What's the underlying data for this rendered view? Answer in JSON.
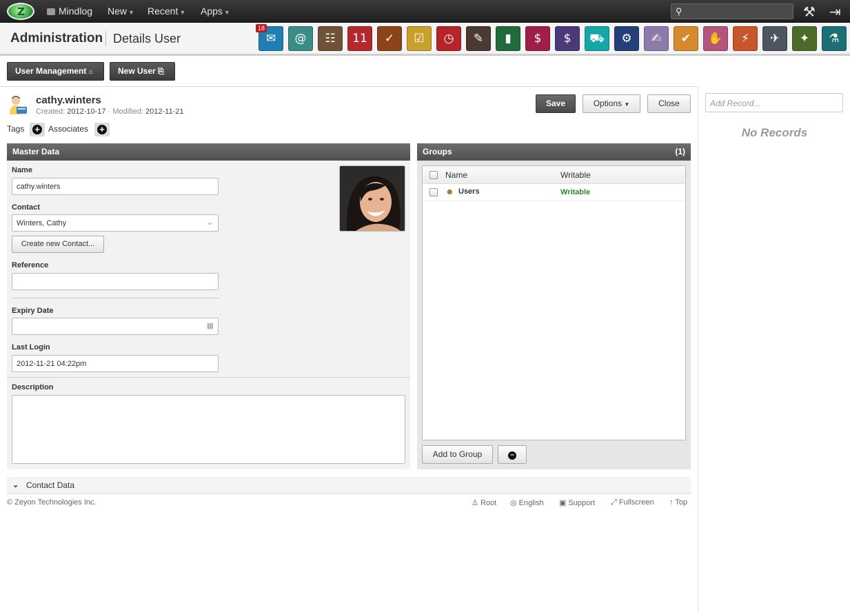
{
  "topbar": {
    "nav": [
      "Mindlog",
      "New",
      "Recent",
      "Apps"
    ],
    "search_placeholder": ""
  },
  "header": {
    "title": "Administration",
    "subtitle": "Details User",
    "apps": [
      {
        "name": "mail-icon",
        "color": "#1f7fb2",
        "badge": "18",
        "glyph": "✉"
      },
      {
        "name": "address-book-icon",
        "color": "#3c8c86",
        "glyph": "@"
      },
      {
        "name": "contacts-icon",
        "color": "#6e5337",
        "glyph": "☷"
      },
      {
        "name": "calendar-icon",
        "color": "#b3282c",
        "glyph": "11"
      },
      {
        "name": "tasks-folder-icon",
        "color": "#8a4417",
        "glyph": "✓"
      },
      {
        "name": "checklist-icon",
        "color": "#c8a12d",
        "glyph": "☑"
      },
      {
        "name": "stopwatch-icon",
        "color": "#b5242a",
        "glyph": "◷"
      },
      {
        "name": "notes-icon",
        "color": "#4a3a31",
        "glyph": "✎"
      },
      {
        "name": "bookmark-icon",
        "color": "#1f6b3b",
        "glyph": "▮"
      },
      {
        "name": "cashier-icon",
        "color": "#a01e4a",
        "glyph": "$"
      },
      {
        "name": "dollar-icon",
        "color": "#4b3a7a",
        "glyph": "$"
      },
      {
        "name": "truck-icon",
        "color": "#16a6a9",
        "glyph": "⛟"
      },
      {
        "name": "support-icon",
        "color": "#253f79",
        "glyph": "⚙"
      },
      {
        "name": "document-person-icon",
        "color": "#8c7aa8",
        "glyph": "✍"
      },
      {
        "name": "document-check-icon",
        "color": "#d58a2c",
        "glyph": "✔"
      },
      {
        "name": "handshake-icon",
        "color": "#b3557c",
        "glyph": "✋"
      },
      {
        "name": "antenna-icon",
        "color": "#c8562a",
        "glyph": "⚡"
      },
      {
        "name": "cart-icon",
        "color": "#4c5560",
        "glyph": "✈"
      },
      {
        "name": "price-tag-icon",
        "color": "#4c6b2a",
        "glyph": "✦"
      },
      {
        "name": "flask-icon",
        "color": "#1c6f74",
        "glyph": "⚗"
      }
    ]
  },
  "toolbar": {
    "user_management": "User Management",
    "new_user": "New User"
  },
  "record": {
    "username": "cathy.winters",
    "created_label": "Created:",
    "created": "2012-10-17",
    "modified_label": "· Modified:",
    "modified": "2012-11-21",
    "save": "Save",
    "options": "Options",
    "close": "Close",
    "tags": "Tags",
    "associates": "Associates"
  },
  "master": {
    "title": "Master Data",
    "name_label": "Name",
    "name_value": "cathy.winters",
    "contact_label": "Contact",
    "contact_value": "Winters, Cathy",
    "create_contact": "Create new Contact...",
    "reference_label": "Reference",
    "reference_value": "",
    "expiry_label": "Expiry Date",
    "expiry_value": "",
    "last_login_label": "Last Login",
    "last_login_value": "2012-11-21 04:22pm",
    "description_label": "Description",
    "description_value": ""
  },
  "groups": {
    "title": "Groups",
    "count": "(1)",
    "col_name": "Name",
    "col_writable": "Writable",
    "rows": [
      {
        "name": "Users",
        "writable": "Writable"
      }
    ],
    "add": "Add to Group"
  },
  "contact_data": "Contact Data",
  "sidebar": {
    "add_record_placeholder": "Add Record...",
    "no_records": "No Records"
  },
  "footer": {
    "copyright": "© Zeyon Technologies Inc.",
    "links": [
      "Root",
      "English",
      "Support",
      "Fullscreen",
      "Top"
    ]
  }
}
